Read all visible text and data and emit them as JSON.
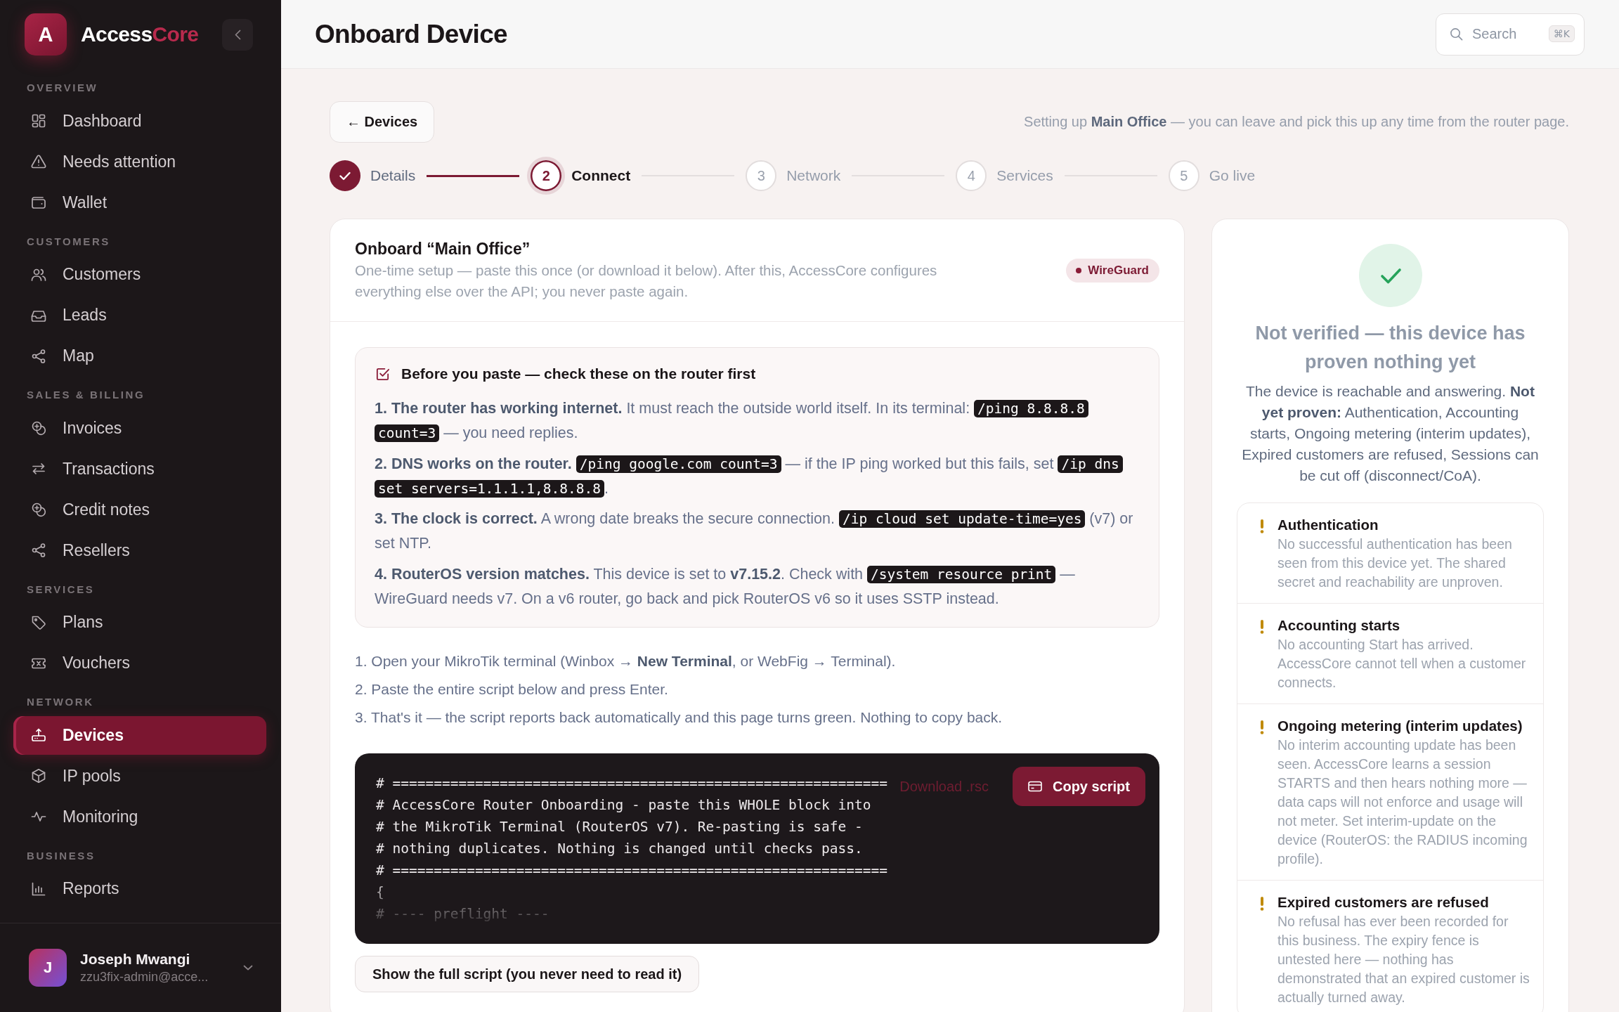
{
  "sidebar": {
    "brand": {
      "mark": "A",
      "name": "Access",
      "accent": "Core"
    },
    "sections": [
      {
        "title": "OVERVIEW",
        "items": [
          {
            "label": "Dashboard",
            "selected": false
          },
          {
            "label": "Needs attention",
            "selected": false
          },
          {
            "label": "Wallet",
            "selected": false
          }
        ]
      },
      {
        "title": "CUSTOMERS",
        "items": [
          {
            "label": "Customers",
            "selected": false
          },
          {
            "label": "Leads",
            "selected": false
          },
          {
            "label": "Map",
            "selected": false
          }
        ]
      },
      {
        "title": "SALES & BILLING",
        "items": [
          {
            "label": "Invoices",
            "selected": false
          },
          {
            "label": "Transactions",
            "selected": false
          },
          {
            "label": "Credit notes",
            "selected": false
          },
          {
            "label": "Resellers",
            "selected": false
          }
        ]
      },
      {
        "title": "SERVICES",
        "items": [
          {
            "label": "Plans",
            "selected": false
          },
          {
            "label": "Vouchers",
            "selected": false
          }
        ]
      },
      {
        "title": "NETWORK",
        "items": [
          {
            "label": "Devices",
            "selected": true
          },
          {
            "label": "IP pools",
            "selected": false
          },
          {
            "label": "Monitoring",
            "selected": false
          }
        ]
      },
      {
        "title": "BUSINESS",
        "items": [
          {
            "label": "Reports",
            "selected": false
          }
        ]
      }
    ],
    "user": {
      "initial": "J",
      "name": "Joseph Mwangi",
      "email": "zzu3fix-admin@acce..."
    }
  },
  "header": {
    "title": "Onboard Device",
    "search": {
      "placeholder": "Search",
      "shortcut": "⌘K"
    }
  },
  "toolbar": {
    "back_button": "← Devices",
    "note": "Setting up **Main Office** — you can leave and pick this up any time from the router page."
  },
  "stepper": [
    {
      "label": "Details",
      "completed": true,
      "selected": false
    },
    {
      "number": "2",
      "label": "Connect",
      "completed": false,
      "selected": true
    },
    {
      "number": "3",
      "label": "Network",
      "completed": false,
      "selected": false
    },
    {
      "number": "4",
      "label": "Services",
      "completed": false,
      "selected": false
    },
    {
      "number": "5",
      "label": "Go live",
      "completed": false,
      "selected": false
    }
  ],
  "onboard_card": {
    "title": "Onboard “Main Office”",
    "subtitle": "One-time setup — paste this once (or download it below). After this, AccessCore configures everything else over the API; you never paste again.",
    "badge": "WireGuard",
    "checklist": {
      "title": "Before you paste — check these on the router first",
      "items": [
        {
          "parts": [
            {
              "kind": "text",
              "text": "**1. The router has working internet.** It must reach the outside world itself. In its terminal: "
            },
            {
              "kind": "code",
              "text": "/ping 8.8.8.8 count=3"
            },
            {
              "kind": "text",
              "text": " — you need replies."
            }
          ]
        },
        {
          "parts": [
            {
              "kind": "text",
              "text": "**2. DNS works on the router.** "
            },
            {
              "kind": "code",
              "text": "/ping google.com count=3"
            },
            {
              "kind": "text",
              "text": " — if the IP ping worked but this fails, set "
            },
            {
              "kind": "code",
              "text": "/ip dns set servers=1.1.1.1,8.8.8.8"
            },
            {
              "kind": "text",
              "text": "."
            }
          ]
        },
        {
          "parts": [
            {
              "kind": "text",
              "text": "**3. The clock is correct.** A wrong date breaks the secure connection. "
            },
            {
              "kind": "code",
              "text": "/ip cloud set update-time=yes"
            },
            {
              "kind": "text",
              "text": " (v7) or set NTP."
            }
          ]
        },
        {
          "parts": [
            {
              "kind": "text",
              "text": "**4. RouterOS version matches.** This device is set to **v7.15.2**. Check with "
            },
            {
              "kind": "code",
              "text": "/system resource print"
            },
            {
              "kind": "text",
              "text": " — WireGuard needs v7. On a v6 router, go back and pick RouterOS v6 so it uses SSTP instead."
            }
          ]
        }
      ]
    },
    "instructions": [
      "1. Open your MikroTik terminal (Winbox → **New Terminal**, or WebFig → Terminal).",
      "2. Paste the entire script below and press Enter.",
      "3. That's it — the script reports back automatically and this page turns green. Nothing to copy back."
    ],
    "script": {
      "lines": [
        "# ============================================================",
        "# AccessCore Router Onboarding - paste this WHOLE block into",
        "# the MikroTik Terminal (RouterOS v7). Re-pasting is safe -",
        "# nothing duplicates. Nothing is changed until checks pass.",
        "# ============================================================",
        "{",
        "# ---- preflight ----"
      ],
      "expanded": false,
      "download_link": "Download .rsc",
      "copy_button": "Copy script"
    },
    "show_full_button": "Show the full script (you never need to read it)"
  },
  "verification": {
    "title": "Not verified — this device has proven nothing yet",
    "description": "The device is reachable and answering. **Not yet proven:** Authentication, Accounting starts, Ongoing metering (interim updates), Expired customers are refused, Sessions can be cut off (disconnect/CoA).",
    "checks": [
      {
        "title": "Authentication",
        "description": "No successful authentication has been seen from this device yet. The shared secret and reachability are unproven.",
        "passed": false
      },
      {
        "title": "Accounting starts",
        "description": "No accounting Start has arrived. AccessCore cannot tell when a customer connects.",
        "passed": false
      },
      {
        "title": "Ongoing metering (interim updates)",
        "description": "No interim accounting update has been seen. AccessCore learns a session STARTS and then hears nothing more — data caps will not enforce and usage will not meter. Set interim-update on the device (RouterOS: the RADIUS incoming profile).",
        "passed": false
      },
      {
        "title": "Expired customers are refused",
        "description": "No refusal has ever been recorded for this business. The expiry fence is untested here — nothing has demonstrated that an expired customer is actually turned away.",
        "passed": false
      }
    ]
  }
}
